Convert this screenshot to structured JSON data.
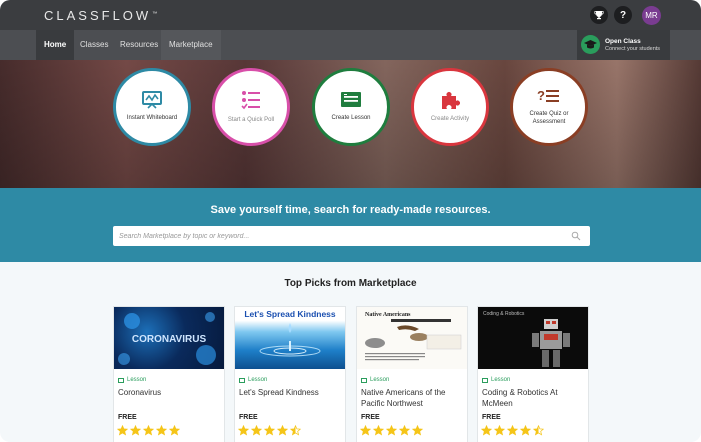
{
  "app": {
    "logo_text": "CLASSFLOW",
    "logo_tm": "™",
    "trophy_icon": "trophy-icon",
    "help_label": "?",
    "avatar_initials": "MR"
  },
  "nav": {
    "items": [
      {
        "label": "Home",
        "active": true
      },
      {
        "label": "Classes",
        "active": false
      },
      {
        "label": "Resources",
        "active": false
      },
      {
        "label": "Marketplace",
        "active": false
      }
    ],
    "open_class": {
      "title": "Open Class",
      "subtitle": "Connect your students",
      "icon": "graduation-cap-icon"
    }
  },
  "actions": [
    {
      "label": "Instant Whiteboard",
      "color": "#2e8aa5",
      "icon": "whiteboard-icon",
      "muted": false
    },
    {
      "label": "Start a Quick Poll",
      "color": "#d84fa9",
      "icon": "poll-icon",
      "muted": true
    },
    {
      "label": "Create Lesson",
      "color": "#1f7d3e",
      "icon": "lesson-icon",
      "muted": false
    },
    {
      "label": "Create Activity",
      "color": "#d9363e",
      "icon": "puzzle-icon",
      "muted": true
    },
    {
      "label": "Create Quiz or Assessment",
      "color": "#8a3e24",
      "icon": "quiz-icon",
      "muted": false
    }
  ],
  "search": {
    "title": "Save yourself time, search for ready-made resources.",
    "placeholder": "Search Marketplace by topic or keyword...",
    "icon": "search-icon"
  },
  "picks": {
    "title": "Top Picks from Marketplace",
    "cards": [
      {
        "type": "Lesson",
        "title": "Coronavirus",
        "price": "FREE",
        "rating": 5,
        "thumb_text": "CORONAVIRUS"
      },
      {
        "type": "Lesson",
        "title": "Let's Spread Kindness",
        "price": "FREE",
        "rating": 4.5,
        "thumb_text": "Let's Spread Kindness"
      },
      {
        "type": "Lesson",
        "title": "Native Americans of the Pacific Northwest",
        "price": "FREE",
        "rating": 5,
        "thumb_text": "Native Americans"
      },
      {
        "type": "Lesson",
        "title": "Coding & Robotics At McMeen",
        "price": "FREE",
        "rating": 4.5,
        "thumb_text": "Coding & Robotics"
      }
    ]
  },
  "colors": {
    "topbar": "#3b3d40",
    "navbar": "#4c4e52",
    "search_band": "#2e8aa5",
    "accent_green": "#2a9d5c",
    "star": "#f5c518"
  }
}
